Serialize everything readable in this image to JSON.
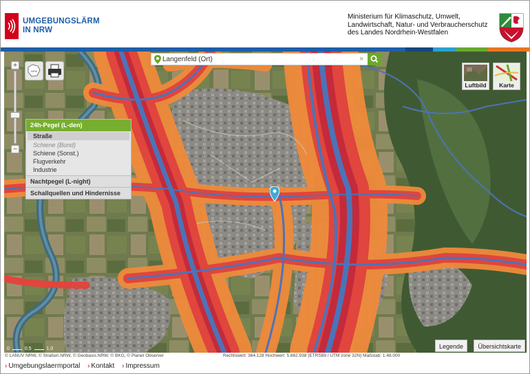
{
  "header": {
    "brand_line1": "UMGEBUNGSLÄRM",
    "brand_line2": "IN NRW",
    "ministry_line1": "Ministerium für Klimaschutz, Umwelt,",
    "ministry_line2": "Landwirtschaft, Natur- und Verbraucherschutz",
    "ministry_line3": "des Landes Nordrhein-Westfalen",
    "colorbar": [
      "#1f5ea8",
      "#1f5ea8",
      "#2aa0d0",
      "#6aa82e",
      "#e87722"
    ]
  },
  "map": {
    "search": {
      "value": "Langenfeld (Ort)",
      "clear_glyph": "×"
    },
    "zoom": {
      "plus": "+",
      "minus": "−"
    },
    "map_types": [
      {
        "label": "Luftbild"
      },
      {
        "label": "Karte"
      }
    ],
    "layers": {
      "header": "24h-Pegel (L-den)",
      "items": [
        {
          "label": "Straße",
          "state": "selected"
        },
        {
          "label": "Schiene (Bund)",
          "state": "disabled"
        },
        {
          "label": "Schiene (Sonst.)",
          "state": "normal"
        },
        {
          "label": "Flugverkehr",
          "state": "normal"
        },
        {
          "label": "Industrie",
          "state": "normal"
        }
      ],
      "section2": "Nachtpegel (L-night)",
      "section3": "Schallquellen und Hindernisse"
    },
    "scale_labels": [
      "0",
      "0.5",
      "1.0"
    ],
    "buttons": {
      "legend": "Legende",
      "overview": "Übersichtskarte"
    },
    "colors": {
      "noise_orange": "#f08a3a",
      "noise_red": "#e0453e",
      "noise_darkred": "#c42a3a",
      "road_blue": "#4d73b8",
      "brand_red": "#d4001a",
      "brand_green": "#6aa82e"
    }
  },
  "footer": {
    "credits": "© LANUV NRW, © Straßen.NRW, © Geobasis.NRW, © BKG, © Planet Observer",
    "coords": "Rechtswert: 364.128  Hochwert: 5.662.938 (ETRS89 / UTM zone 32N)   Maßstab: 1:48.000",
    "links": [
      {
        "label": "Umgebungslaermportal"
      },
      {
        "label": "Kontakt"
      },
      {
        "label": "Impressum"
      }
    ],
    "arrow": "›"
  }
}
